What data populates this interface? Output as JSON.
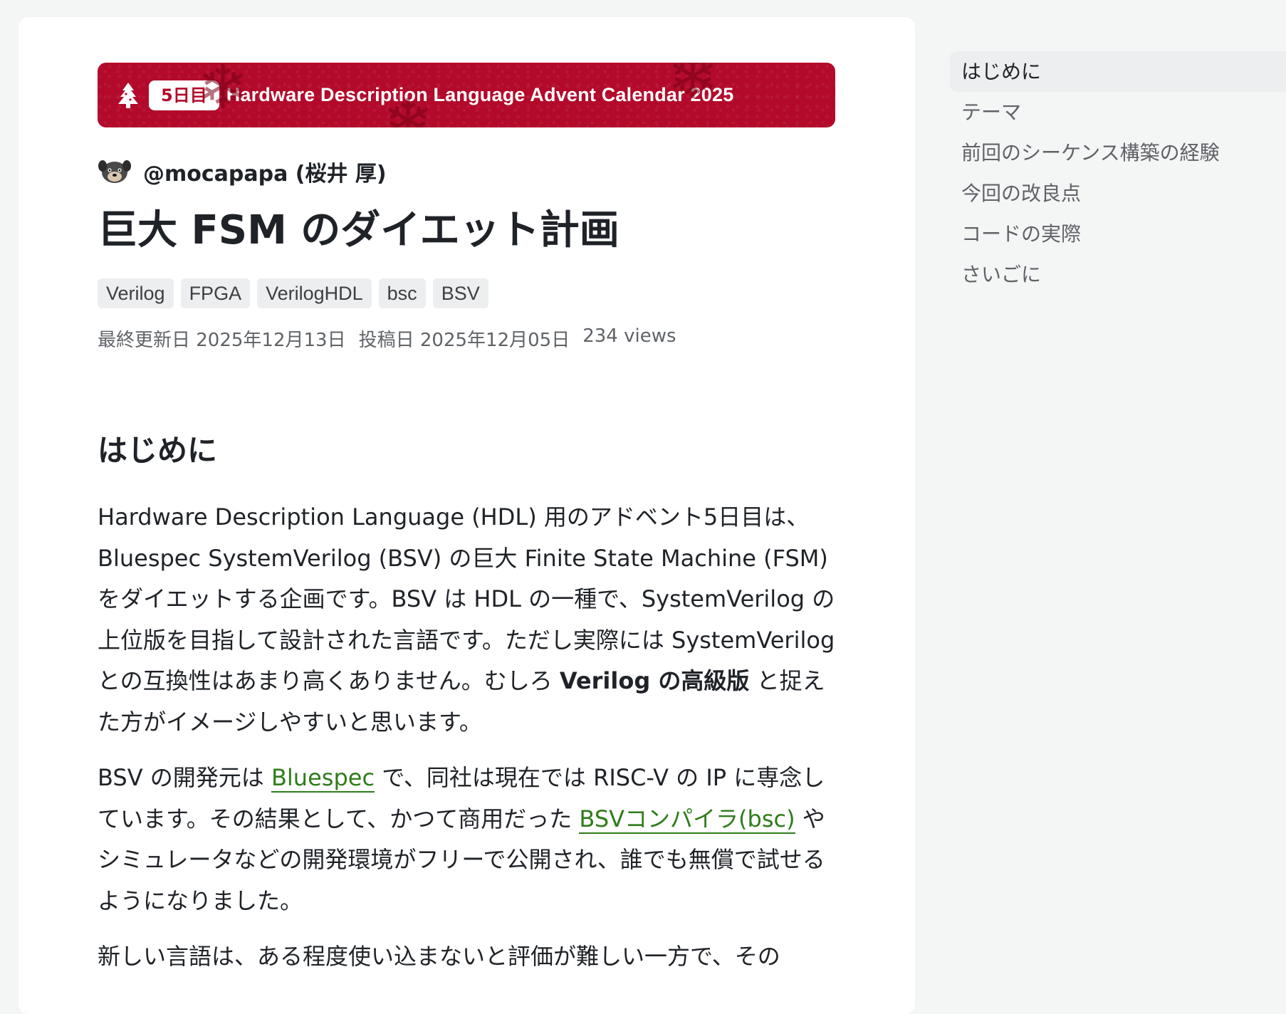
{
  "banner": {
    "day_badge": "5日目",
    "title": "Hardware Description Language Advent Calendar 2025",
    "tree_icon": "tree-icon",
    "color": "#b3092a"
  },
  "author": {
    "handle": "@mocapapa (桜井 厚)",
    "avatar_icon": "dog-avatar-icon"
  },
  "article": {
    "title": "巨大 FSM のダイエット計画",
    "tags": [
      "Verilog",
      "FPGA",
      "VerilogHDL",
      "bsc",
      "BSV"
    ],
    "updated": "最終更新日 2025年12月13日",
    "posted": "投稿日 2025年12月05日",
    "views": "234 views",
    "section_heading": "はじめに",
    "p1_a": "Hardware Description Language (HDL) 用のアドベント5日目は、Bluespec SystemVerilog (BSV) の巨大 Finite State Machine (FSM) をダイエットする企画です。BSV は HDL の一種で、SystemVerilog の上位版を目指して設計された言語です。ただし実際には SystemVerilog との互換性はあまり高くありません。むしろ ",
    "p1_bold": "Verilog の高級版",
    "p1_b": " と捉えた方がイメージしやすいと思います。",
    "p2_a": "BSV の開発元は ",
    "p2_link1": "Bluespec",
    "p2_b": " で、同社は現在では RISC-V の IP に専念しています。その結果として、かつて商用だった ",
    "p2_link2": "BSVコンパイラ(bsc)",
    "p2_c": " やシミュレータなどの開発環境がフリーで公開され、誰でも無償で試せるようになりました。",
    "p3": "新しい言語は、ある程度使い込まないと評価が難しい一方で、その",
    "link_color": "#2f7d1a"
  },
  "toc": {
    "items": [
      "はじめに",
      "テーマ",
      "前回のシーケンス構築の経験",
      "今回の改良点",
      "コードの実際",
      "さいごに"
    ],
    "active": "はじめに"
  }
}
